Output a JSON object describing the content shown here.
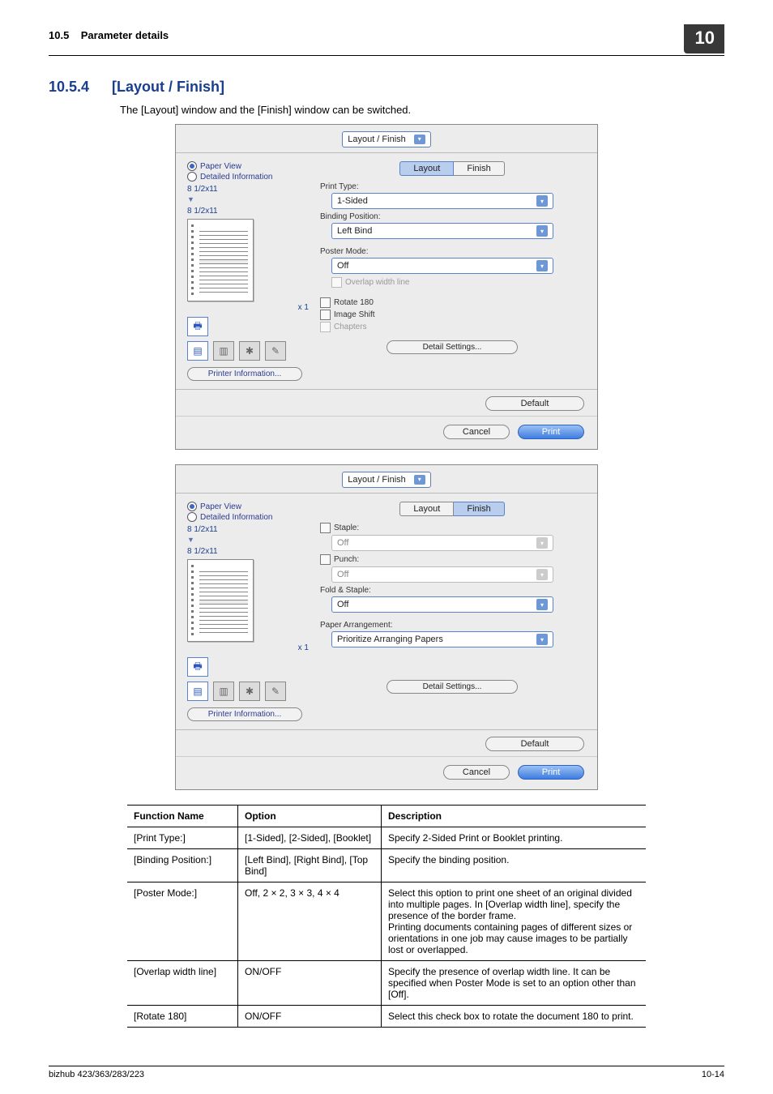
{
  "header": {
    "left_num": "10.5",
    "left_title": "Parameter details",
    "badge": "10"
  },
  "section": {
    "num": "10.5.4",
    "title": "[Layout / Finish]",
    "desc": "The [Layout] window and the [Finish] window can be switched."
  },
  "dlg": {
    "panel": "Layout / Finish",
    "side": {
      "paper_view": "Paper View",
      "detailed_info": "Detailed Information",
      "size": "8 1/2x11",
      "x1": "x 1",
      "printer_info": "Printer Information..."
    },
    "tabs": {
      "layout": "Layout",
      "finish": "Finish"
    },
    "layout": {
      "print_type_label": "Print Type:",
      "print_type_value": "1-Sided",
      "binding_label": "Binding Position:",
      "binding_value": "Left Bind",
      "poster_label": "Poster Mode:",
      "poster_value": "Off",
      "overlap": "Overlap width line",
      "rotate": "Rotate 180",
      "shift": "Image Shift",
      "chapters": "Chapters",
      "detail": "Detail Settings..."
    },
    "finish": {
      "staple_label": "Staple:",
      "staple_value": "Off",
      "punch_label": "Punch:",
      "punch_value": "Off",
      "fold_label": "Fold & Staple:",
      "fold_value": "Off",
      "arrange_label": "Paper Arrangement:",
      "arrange_value": "Prioritize Arranging Papers",
      "detail": "Detail Settings..."
    },
    "default": "Default",
    "cancel": "Cancel",
    "print": "Print"
  },
  "table": {
    "head": {
      "fn": "Function Name",
      "opt": "Option",
      "desc": "Description"
    },
    "rows": [
      {
        "fn": "[Print Type:]",
        "opt": "[1-Sided], [2-Sided], [Booklet]",
        "desc": "Specify 2-Sided Print or Booklet printing."
      },
      {
        "fn": "[Binding Position:]",
        "opt": "[Left Bind], [Right Bind], [Top Bind]",
        "desc": "Specify the binding position."
      },
      {
        "fn": "[Poster Mode:]",
        "opt": "Off, 2 × 2, 3 × 3, 4 × 4",
        "desc": "Select this option to print one sheet of an original divided into multiple pages. In [Overlap width line], specify the presence of the border frame.\nPrinting documents containing pages of different sizes or orientations in one job may cause images to be partially lost or overlapped."
      },
      {
        "fn": "[Overlap width line]",
        "opt": "ON/OFF",
        "desc": "Specify the presence of overlap width line. It can be specified when Poster Mode is set to an option other than [Off]."
      },
      {
        "fn": "[Rotate 180]",
        "opt": "ON/OFF",
        "desc": "Select this check box to rotate the document 180 to print."
      }
    ]
  },
  "footer": {
    "model": "bizhub 423/363/283/223",
    "page": "10-14"
  }
}
